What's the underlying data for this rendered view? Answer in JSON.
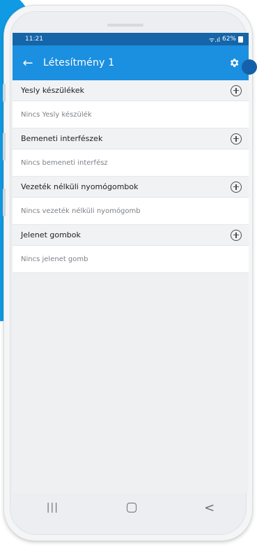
{
  "status_bar": {
    "time": "11:21",
    "signal": "ᯤ.ıl",
    "battery": "62%"
  },
  "header": {
    "title": "Létesítmény 1"
  },
  "sections": [
    {
      "title": "Yesly készülékek",
      "empty_text": "Nincs Yesly készülék"
    },
    {
      "title": "Bemeneti interfészek",
      "empty_text": "Nincs bemeneti interfész"
    },
    {
      "title": "Vezeték nélküli nyomógombok",
      "empty_text": "Nincs vezeték nélküli nyomógomb"
    },
    {
      "title": "Jelenet gombok",
      "empty_text": "Nincs jelenet gomb"
    }
  ],
  "nav": {
    "recents": "|||",
    "back": "<"
  },
  "colors": {
    "appbar": "#1b8fe0",
    "statusbar": "#1565a8",
    "accent_blob": "#0f9ae3"
  }
}
